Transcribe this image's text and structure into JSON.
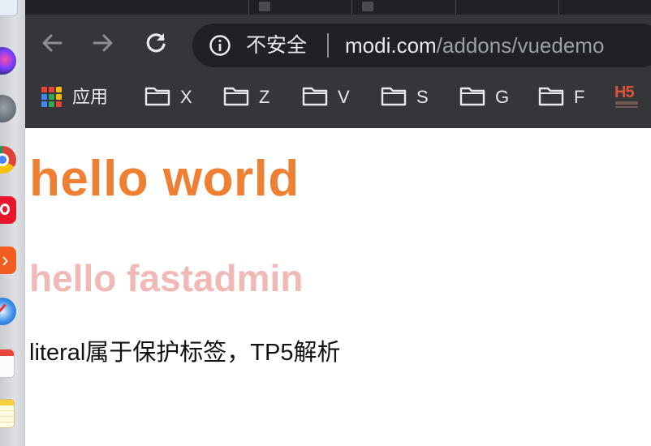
{
  "browser": {
    "address_bar": {
      "security_label": "不安全",
      "url_host": "modi.com",
      "url_path": "/addons/vuedemo"
    },
    "bookmarks": [
      {
        "label": "应用",
        "icon": "apps-grid-icon"
      },
      {
        "label": "X",
        "icon": "folder-icon"
      },
      {
        "label": "Z",
        "icon": "folder-icon"
      },
      {
        "label": "V",
        "icon": "folder-icon"
      },
      {
        "label": "S",
        "icon": "folder-icon"
      },
      {
        "label": "G",
        "icon": "folder-icon"
      },
      {
        "label": "F",
        "icon": "folder-icon"
      }
    ],
    "bookmark_logo": "H5",
    "nav_icons": [
      "back-arrow-icon",
      "forward-arrow-icon",
      "reload-icon",
      "info-icon"
    ]
  },
  "page": {
    "heading1": "hello world",
    "heading2": "hello fastadmin",
    "paragraph": "literal属于保护标签，TP5解析"
  },
  "colors": {
    "heading1": "#ee7f33",
    "heading2": "#f0b9b6",
    "chrome_toolbar": "#35363a",
    "omnibox": "#202124",
    "h5_logo": "#e0533a"
  },
  "dock_icons": [
    "finder-icon",
    "siri-icon",
    "launchpad-icon",
    "chrome-icon",
    "weibo-icon",
    "parallels-icon",
    "safari-icon",
    "calendar-icon",
    "notes-icon"
  ]
}
